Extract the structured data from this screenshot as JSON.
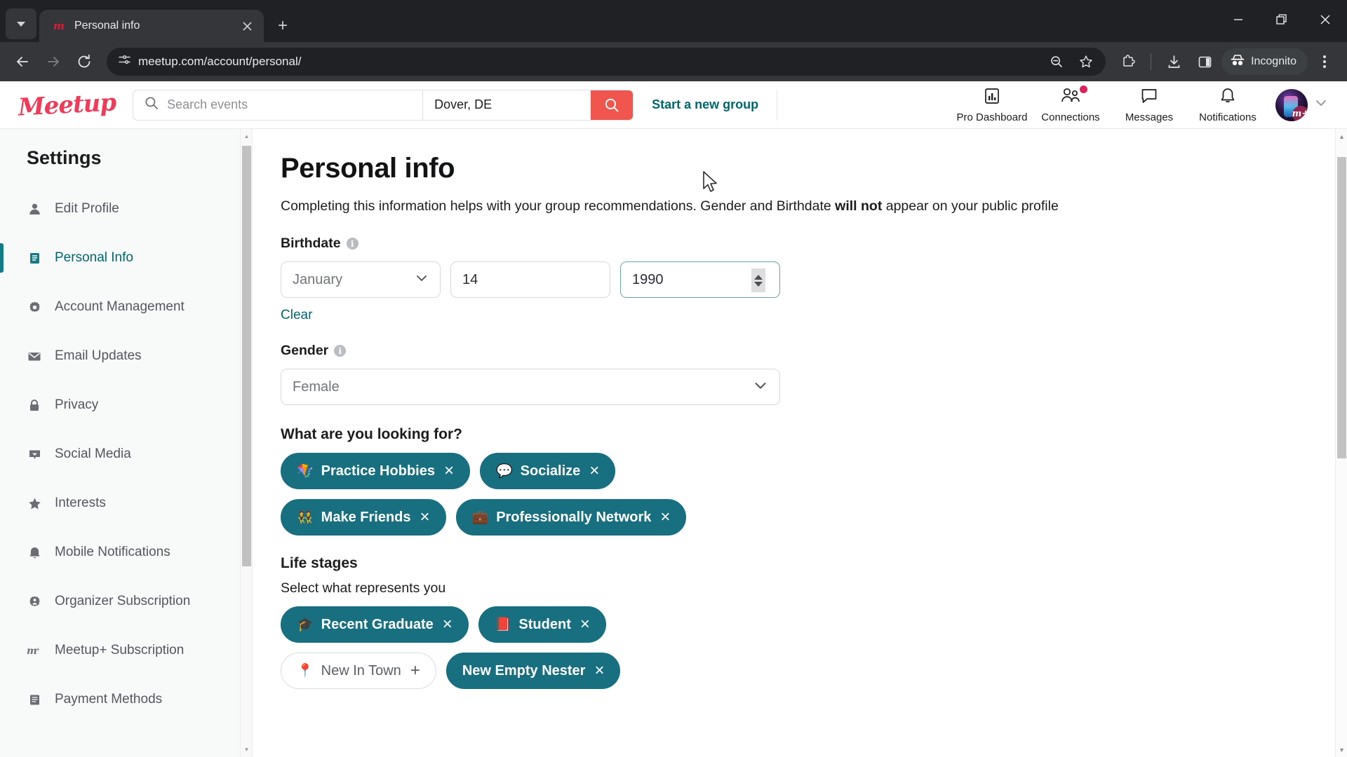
{
  "browser": {
    "tab": {
      "title": "Personal info",
      "favicon": "meetup-m-icon"
    },
    "newtab_label": "+",
    "url": "meetup.com/account/personal/",
    "profile_label": "Incognito",
    "window": {
      "minimize": "–",
      "maximize": "□",
      "close": "×"
    }
  },
  "site_header": {
    "logo": "Meetup",
    "search": {
      "placeholder": "Search events",
      "value": ""
    },
    "location": {
      "value": "Dover, DE"
    },
    "start_group_label": "Start a new group",
    "nav": [
      {
        "label": "Pro Dashboard",
        "icon": "chart-bar-icon",
        "badge": false
      },
      {
        "label": "Connections",
        "icon": "people-icon",
        "badge": true
      },
      {
        "label": "Messages",
        "icon": "chat-bubble-icon",
        "badge": false
      },
      {
        "label": "Notifications",
        "icon": "bell-icon",
        "badge": false
      }
    ],
    "avatar_badge": "m+"
  },
  "sidebar": {
    "title": "Settings",
    "items": [
      {
        "label": "Edit Profile",
        "icon": "person-icon",
        "active": false
      },
      {
        "label": "Personal Info",
        "icon": "document-icon",
        "active": true
      },
      {
        "label": "Account Management",
        "icon": "gear-icon",
        "active": false
      },
      {
        "label": "Email Updates",
        "icon": "envelope-icon",
        "active": false
      },
      {
        "label": "Privacy",
        "icon": "lock-icon",
        "active": false
      },
      {
        "label": "Social Media",
        "icon": "social-icon",
        "active": false
      },
      {
        "label": "Interests",
        "icon": "star-icon",
        "active": false
      },
      {
        "label": "Mobile Notifications",
        "icon": "bell-icon",
        "active": false
      },
      {
        "label": "Organizer Subscription",
        "icon": "gear-person-icon",
        "active": false
      },
      {
        "label": "Meetup+ Subscription",
        "icon": "meetup-plus-icon",
        "active": false
      },
      {
        "label": "Payment Methods",
        "icon": "card-icon",
        "active": false
      }
    ]
  },
  "main": {
    "title": "Personal info",
    "lede_before": "Completing this information helps with your group recommendations. Gender and Birthdate ",
    "lede_bold": "will not",
    "lede_after": " appear on your public profile",
    "birthdate": {
      "label": "Birthdate",
      "month": "January",
      "day": "14",
      "year": "1990",
      "clear_label": "Clear"
    },
    "gender": {
      "label": "Gender",
      "value": "Female"
    },
    "looking_for": {
      "title": "What are you looking for?",
      "pills": [
        {
          "emoji": "🪁",
          "label": "Practice Hobbies",
          "selected": true,
          "action": "×"
        },
        {
          "emoji": "💬",
          "label": "Socialize",
          "selected": true,
          "action": "×"
        },
        {
          "emoji": "👯",
          "label": "Make Friends",
          "selected": true,
          "action": "×"
        },
        {
          "emoji": "💼",
          "label": "Professionally Network",
          "selected": true,
          "action": "×"
        }
      ]
    },
    "life_stages": {
      "title": "Life stages",
      "subtitle": "Select what represents you",
      "pills": [
        {
          "emoji": "🎓",
          "label": "Recent Graduate",
          "selected": true,
          "action": "×"
        },
        {
          "emoji": "📕",
          "label": "Student",
          "selected": true,
          "action": "×"
        },
        {
          "emoji": "📍",
          "label": "New In Town",
          "selected": false,
          "action": "+"
        },
        {
          "emoji": "",
          "label": "New Empty Nester",
          "selected": true,
          "action": "×"
        }
      ]
    }
  },
  "colors": {
    "teal": "#176f80",
    "teal_link": "#00676e",
    "meetup_red": "#f13a59",
    "search_btn": "#f1564e",
    "badge": "#e0205c"
  }
}
